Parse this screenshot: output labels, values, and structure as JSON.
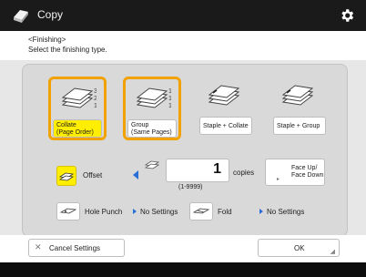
{
  "app": {
    "title": "Copy",
    "app_icon": "copy-app-icon",
    "settings_icon": "gear-icon"
  },
  "header": {
    "breadcrumb": "<Finishing>",
    "instruction": "Select the finishing type."
  },
  "finishing_options": [
    {
      "label_line1": "Collate",
      "label_line2": "(Page Order)",
      "selected": true,
      "highlight": true
    },
    {
      "label_line1": "Group",
      "label_line2": "(Same Pages)",
      "selected": true,
      "highlight": false
    },
    {
      "label_line1": "Staple + Collate",
      "label_line2": "",
      "selected": false,
      "highlight": false
    },
    {
      "label_line1": "Staple + Group",
      "label_line2": "",
      "selected": false,
      "highlight": false
    }
  ],
  "offset": {
    "label": "Offset"
  },
  "copies": {
    "value": "1",
    "unit": "copies",
    "range": "(1-9999)"
  },
  "face": {
    "line1": "Face Up/",
    "line2": "Face Down"
  },
  "hole_punch": {
    "label": "Hole Punch",
    "status": "No Settings"
  },
  "fold": {
    "label": "Fold",
    "status": "No Settings"
  },
  "actions": {
    "cancel": "Cancel Settings",
    "ok": "OK"
  },
  "colors": {
    "accent": "#f2a200",
    "highlight": "#ffee00",
    "titlebar": "#1a1a1a",
    "arrow": "#2a6fd6"
  }
}
